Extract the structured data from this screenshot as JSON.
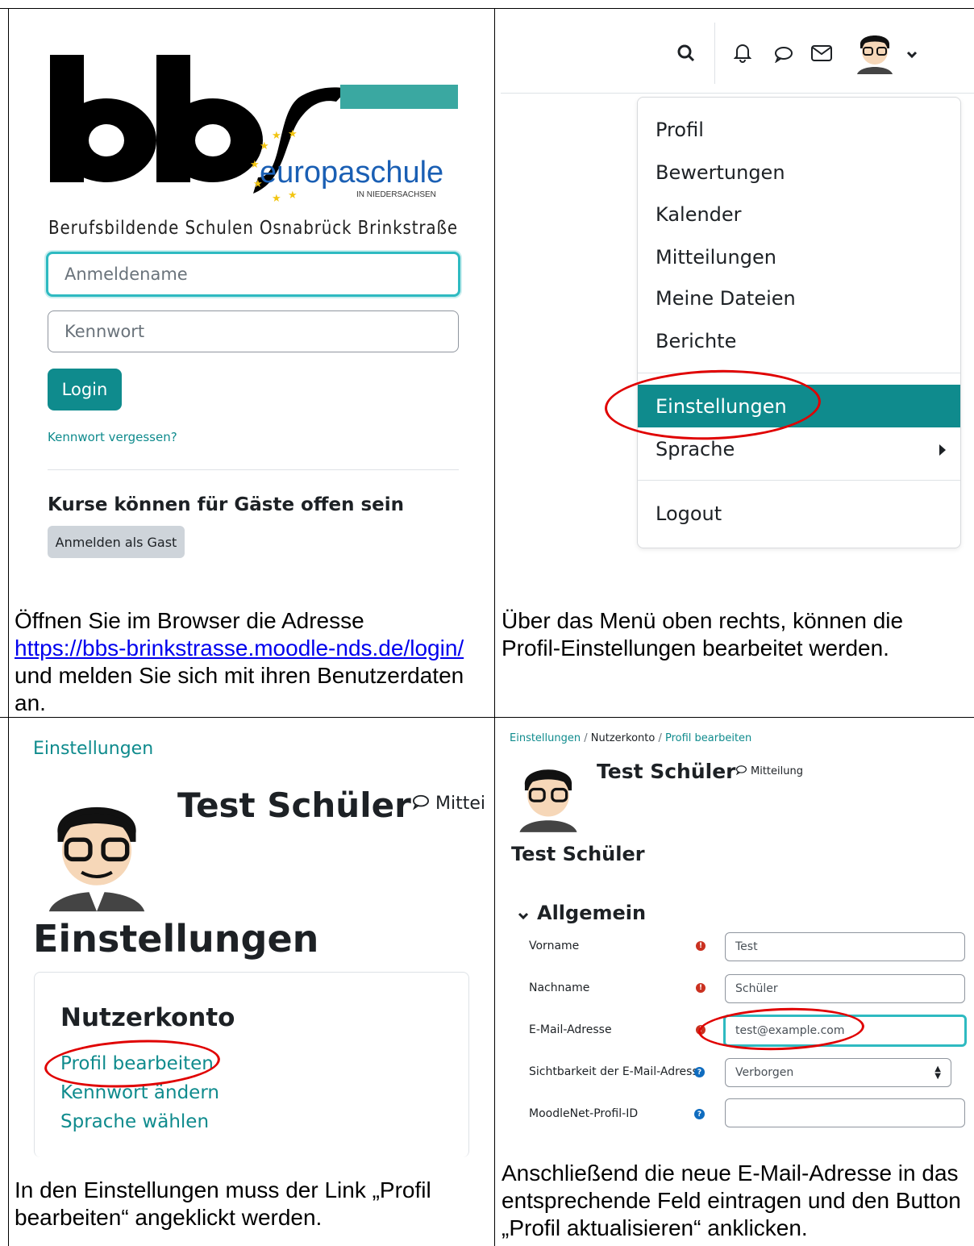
{
  "login": {
    "logo": {
      "word": "europaschule",
      "sub": "IN NIEDERSACHSEN",
      "tagline": "Berufsbildende Schulen Osnabrück Brinkstraße"
    },
    "username_placeholder": "Anmeldename",
    "password_placeholder": "Kennwort",
    "login_button": "Login",
    "forgot_link": "Kennwort vergessen?",
    "guest_heading": "Kurse können für Gäste offen sein",
    "guest_button": "Anmelden als Gast"
  },
  "user_menu": {
    "items": [
      "Profil",
      "Bewertungen",
      "Kalender",
      "Mitteilungen",
      "Meine Dateien",
      "Berichte"
    ],
    "settings": "Einstellungen",
    "language": "Sprache",
    "logout": "Logout",
    "icons": [
      "search-icon",
      "bell-icon",
      "chat-icon",
      "envelope-icon",
      "avatar",
      "chevron-down-icon"
    ]
  },
  "settings_page": {
    "breadcrumb": "Einstellungen",
    "user_name": "Test Schüler",
    "message_button": "Mittei",
    "heading": "Einstellungen",
    "card_title": "Nutzerkonto",
    "links": [
      "Profil bearbeiten",
      "Kennwort ändern",
      "Sprache wählen"
    ]
  },
  "edit_profile": {
    "breadcrumb": [
      "Einstellungen",
      "Nutzerkonto",
      "Profil bearbeiten"
    ],
    "user_name": "Test Schüler",
    "message_button": "Mitteilung",
    "subtitle": "Test Schüler",
    "section": "Allgemein",
    "fields": [
      {
        "label": "Vorname",
        "value": "Test"
      },
      {
        "label": "Nachname",
        "value": "Schüler"
      },
      {
        "label": "E-Mail-Adresse",
        "value": "test@example.com"
      },
      {
        "label": "Sichtbarkeit der E-Mail-Adresse",
        "value": "Verborgen"
      },
      {
        "label": "MoodleNet-Profil-ID",
        "value": ""
      }
    ]
  },
  "captions": {
    "q1_pre": "Öffnen Sie im Browser die Adresse",
    "q1_link": "https://bbs-brinkstrasse.moodle-nds.de/login/",
    "q1_post": "und melden Sie sich mit ihren Benutzerdaten an.",
    "q2": "Über das Menü oben rechts, können die Profil-Einstellungen bearbeitet werden.",
    "q3": "In den Einstellungen muss der Link „Profil bearbeiten“ angeklickt werden.",
    "q4": "Anschließend die neue E-Mail-Adresse in das entsprechende Feld eintragen und den Button „Profil aktualisieren“ anklicken."
  },
  "colors": {
    "accent": "#0f8b8d",
    "highlight": "#e00000",
    "required": "#ca3120"
  }
}
